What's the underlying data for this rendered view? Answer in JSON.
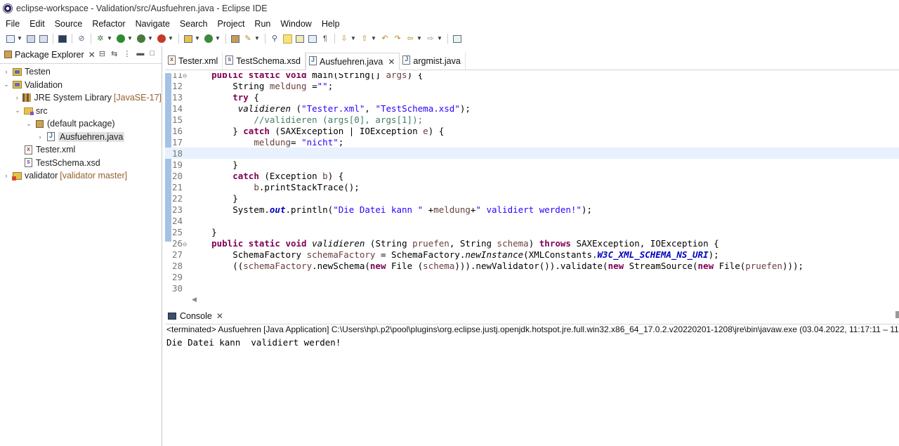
{
  "window": {
    "title": "eclipse-workspace - Validation/src/Ausfuehren.java - Eclipse IDE"
  },
  "menu": [
    "File",
    "Edit",
    "Source",
    "Refactor",
    "Navigate",
    "Search",
    "Project",
    "Run",
    "Window",
    "Help"
  ],
  "package_explorer": {
    "tab_label": "Package Explorer",
    "tree": [
      {
        "label": "Testen",
        "decoration": "",
        "icon": "project-icon",
        "expanded": false
      },
      {
        "label": "Validation",
        "decoration": "",
        "icon": "project-icon",
        "expanded": true
      },
      {
        "label": "JRE System Library",
        "decoration": "[JavaSE-17]",
        "icon": "library-icon",
        "expanded": false
      },
      {
        "label": "src",
        "decoration": "",
        "icon": "source-folder-icon",
        "expanded": true
      },
      {
        "label": "(default package)",
        "decoration": "",
        "icon": "package-icon",
        "expanded": true
      },
      {
        "label": "Ausfuehren.java",
        "decoration": "",
        "icon": "java-file-icon",
        "expanded": false,
        "selected": true
      },
      {
        "label": "Tester.xml",
        "decoration": "",
        "icon": "xml-file-icon"
      },
      {
        "label": "TestSchema.xsd",
        "decoration": "",
        "icon": "xsd-file-icon"
      },
      {
        "label": "validator",
        "decoration": "[validator master]",
        "icon": "git-project-icon",
        "expanded": false
      }
    ]
  },
  "editor": {
    "tabs": [
      {
        "label": "Tester.xml",
        "icon": "xml-file-icon",
        "active": false
      },
      {
        "label": "TestSchema.xsd",
        "icon": "xsd-file-icon",
        "active": false
      },
      {
        "label": "Ausfuehren.java",
        "icon": "java-file-icon",
        "active": true
      },
      {
        "label": "argmist.java",
        "icon": "java-file-icon",
        "active": false
      }
    ],
    "line_numbers": [
      "11",
      "12",
      "13",
      "14",
      "15",
      "16",
      "17",
      "18",
      "19",
      "20",
      "21",
      "22",
      "23",
      "24",
      "25",
      "26",
      "27",
      "28",
      "29",
      "30"
    ],
    "code_lines": [
      "    public static void main(String[] args) {",
      "        String meldung =\"\";",
      "        try {",
      "         validieren (\"Tester.xml\", \"TestSchema.xsd\");",
      "            //validieren (args[0], args[1]);",
      "        } catch (SAXException | IOException e) {",
      "            meldung= \"nicht\";",
      "",
      "        }",
      "        catch (Exception b) {",
      "            b.printStackTrace();",
      "        }",
      "        System.out.println(\"Die Datei kann \" +meldung+\" validiert werden!\");",
      "",
      "    }",
      "    public static void validieren (String pruefen, String schema) throws SAXException, IOException {",
      "        SchemaFactory schemaFactory = SchemaFactory.newInstance(XMLConstants.W3C_XML_SCHEMA_NS_URI);",
      "        ((schemaFactory.newSchema(new File (schema))).newValidator()).validate(new StreamSource(new File(pruefen)));",
      "",
      ""
    ],
    "current_line": "18"
  },
  "console": {
    "tab_label": "Console",
    "status": "<terminated> Ausfuehren [Java Application] C:\\Users\\hp\\.p2\\pool\\plugins\\org.eclipse.justj.openjdk.hotspot.jre.full.win32.x86_64_17.0.2.v20220201-1208\\jre\\bin\\javaw.exe  (03.04.2022, 11:17:11 – 11:1",
    "output": "Die Datei kann  validiert werden!"
  },
  "colors": {
    "keyword": "#7f0055",
    "string": "#2a00ff",
    "comment": "#3f7f5f",
    "current_line_bg": "#e8f2fe",
    "selection_bg": "#e2e2e2"
  }
}
